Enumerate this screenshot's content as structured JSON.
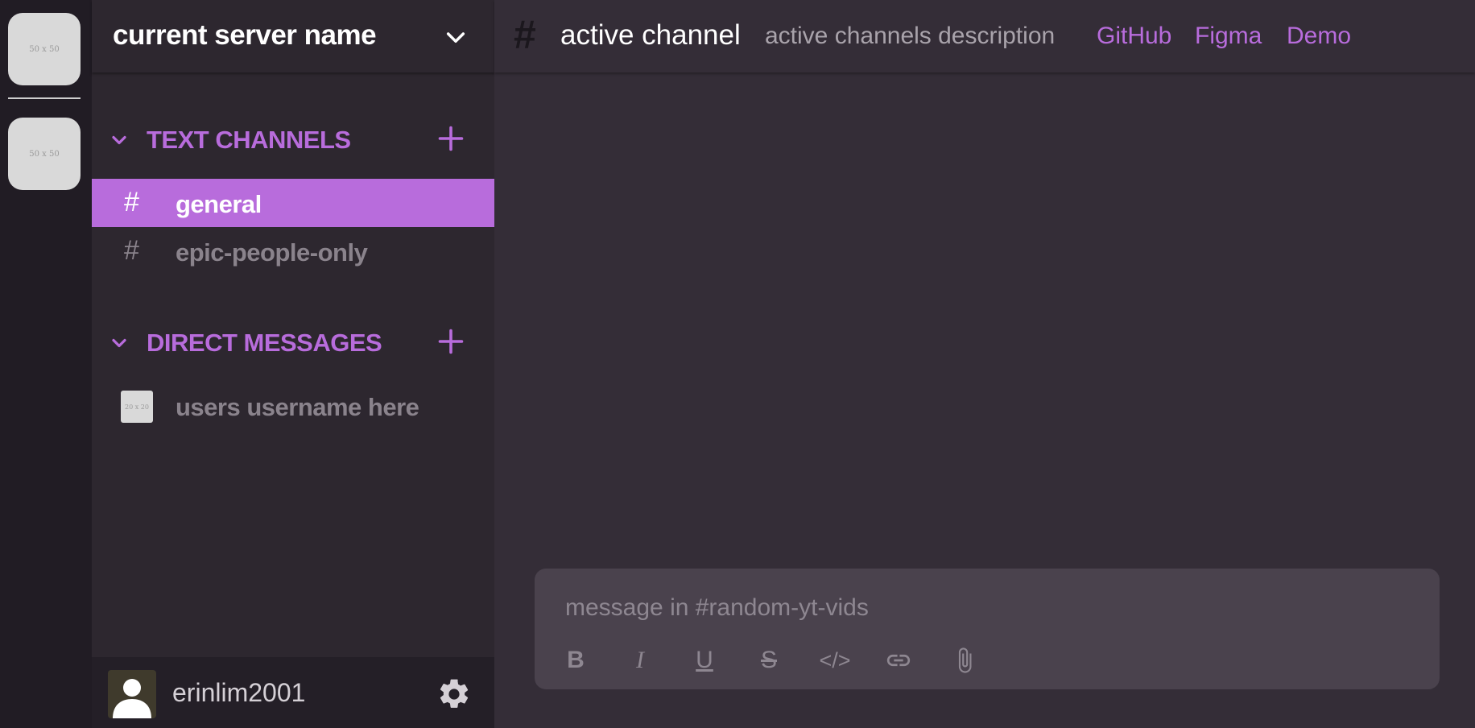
{
  "servers": [
    {
      "placeholder": "50 x 50"
    },
    {
      "placeholder": "50 x 50"
    }
  ],
  "server_header": {
    "name": "current server name"
  },
  "sections": {
    "text_channels": {
      "title": "TEXT CHANNELS",
      "channels": [
        {
          "hash": "#",
          "name": "general",
          "active": true
        },
        {
          "hash": "#",
          "name": "epic-people-only",
          "active": false
        }
      ]
    },
    "direct_messages": {
      "title": "DIRECT MESSAGES",
      "items": [
        {
          "avatar_placeholder": "20 x 20",
          "name": "users username here"
        }
      ]
    }
  },
  "user_bar": {
    "username": "erinlim2001"
  },
  "topbar": {
    "hash": "#",
    "channel_name": "active channel",
    "description": "active channels description",
    "links": [
      "GitHub",
      "Figma",
      "Demo"
    ]
  },
  "composer": {
    "placeholder": "message in #random-yt-vids",
    "tools": {
      "bold": "B",
      "italic": "I",
      "underline": "U",
      "strike": "S",
      "code": "</>"
    }
  },
  "icons": {
    "server_dropdown": "chevron-down-icon",
    "section_toggle": "chevron-down-icon",
    "section_add": "plus-icon",
    "settings": "gear-icon",
    "link": "link-icon",
    "attach": "paperclip-icon"
  },
  "colors": {
    "accent": "#b86cdc",
    "rail_bg": "#211c24",
    "sidebar_bg": "#2d272f",
    "main_bg": "#342d37",
    "composer_bg": "#4a424d",
    "muted_text": "#8a838c"
  }
}
